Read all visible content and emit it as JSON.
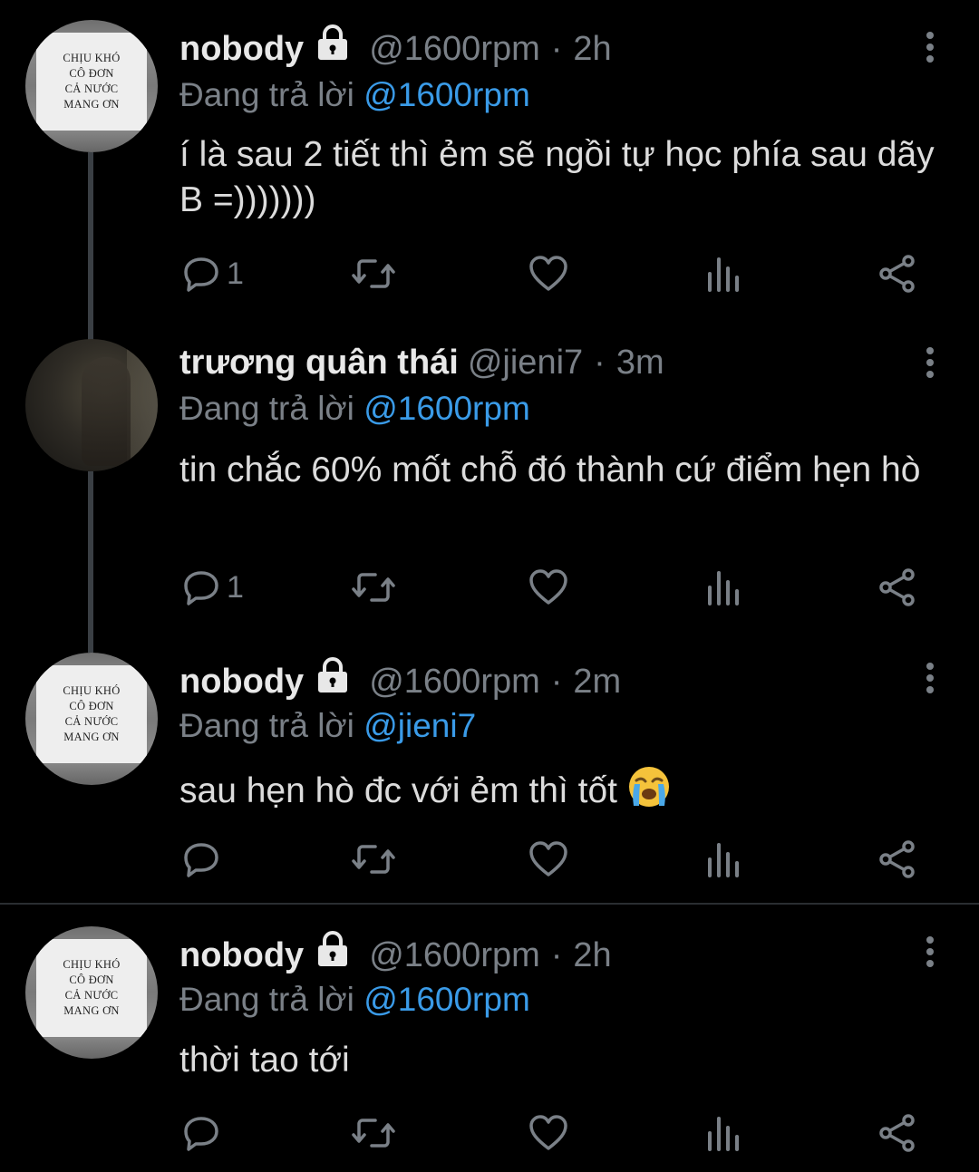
{
  "tweets": [
    {
      "name": "nobody",
      "handle": "@1600rpm",
      "time": "2h",
      "replying_prefix": "Đang trả lời",
      "replying_to": "@1600rpm",
      "text": "í là sau 2 tiết thì ẻm sẽ ngồi tự học phía sau dãy B =)))))))",
      "reply_count": "1",
      "avatar_text": [
        "CHỊU KHÓ",
        "CÔ ĐƠN",
        "CẢ NƯỚC",
        "MANG ƠN"
      ]
    },
    {
      "name": "trương quân thái",
      "handle": "@jieni7",
      "time": "3m",
      "replying_prefix": "Đang trả lời",
      "replying_to": "@1600rpm",
      "text": "tin chắc 60% mốt chỗ đó thành cứ điểm hẹn hò",
      "reply_count": "1"
    },
    {
      "name": "nobody",
      "handle": "@1600rpm",
      "time": "2m",
      "replying_prefix": "Đang trả lời",
      "replying_to": "@jieni7",
      "text": "sau hẹn hò đc với ẻm thì tốt",
      "reply_count": "",
      "avatar_text": [
        "CHỊU KHÓ",
        "CÔ ĐƠN",
        "CẢ NƯỚC",
        "MANG ƠN"
      ]
    },
    {
      "name": "nobody",
      "handle": "@1600rpm",
      "time": "2h",
      "replying_prefix": "Đang trả lời",
      "replying_to": "@1600rpm",
      "text": "thời tao tới",
      "reply_count": "",
      "avatar_text": [
        "CHỊU KHÓ",
        "CÔ ĐƠN",
        "CẢ NƯỚC",
        "MANG ƠN"
      ]
    }
  ],
  "separator": "·",
  "icons": {
    "verified_lock": "lock-icon",
    "more": "more-vertical-icon",
    "reply": "reply-icon",
    "retweet": "retweet-icon",
    "like": "heart-icon",
    "stats": "stats-icon",
    "share": "share-icon",
    "emoji": "loudly-crying-face-emoji"
  },
  "colors": {
    "background": "#000000",
    "accent": "#3a9be8",
    "muted": "#7a8087",
    "text": "#dcdcdc"
  }
}
